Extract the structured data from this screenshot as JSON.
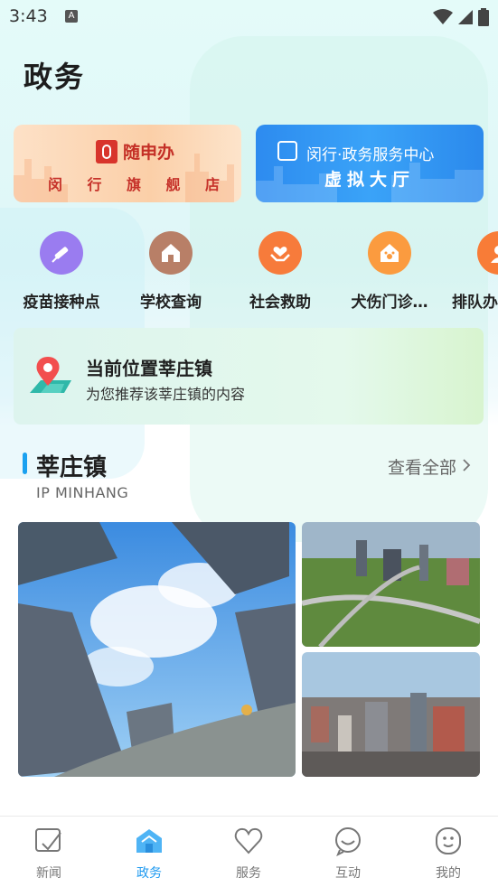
{
  "status": {
    "time": "3:43",
    "notif_letter": "A"
  },
  "page": {
    "title": "政务"
  },
  "banners": {
    "left": {
      "brand": "随申办",
      "chars": [
        "闵",
        "行",
        "旗",
        "舰",
        "店"
      ]
    },
    "right": {
      "title": "闵行·政务服务中心",
      "subtitle": "虚拟大厅"
    }
  },
  "quick_services": [
    {
      "label": "疫苗接种点",
      "icon": "syringe-icon",
      "color": "#9a7cf0"
    },
    {
      "label": "学校查询",
      "icon": "school-icon",
      "color": "#b87f67"
    },
    {
      "label": "社会救助",
      "icon": "heart-hands-icon",
      "color": "#f77b3b"
    },
    {
      "label": "犬伤门诊…",
      "icon": "pet-house-icon",
      "color": "#fb9b3f"
    },
    {
      "label": "排队办",
      "icon": "queue-icon",
      "color": "#f87c37"
    }
  ],
  "location": {
    "title": "当前位置莘庄镇",
    "subtitle": "为您推荐该莘庄镇的内容"
  },
  "section": {
    "title": "莘庄镇",
    "subtitle": "IP MINHANG",
    "more": "查看全部 "
  },
  "tabs": [
    {
      "label": "新闻",
      "icon": "news-icon",
      "active": false
    },
    {
      "label": "政务",
      "icon": "government-icon",
      "active": true
    },
    {
      "label": "服务",
      "icon": "heart-icon",
      "active": false
    },
    {
      "label": "互动",
      "icon": "chat-bubble-icon",
      "active": false
    },
    {
      "label": "我的",
      "icon": "profile-face-icon",
      "active": false
    }
  ],
  "colors": {
    "accent": "#1aa1f0",
    "banner_red": "#c42f26",
    "banner_blue": "#2d8bef"
  }
}
